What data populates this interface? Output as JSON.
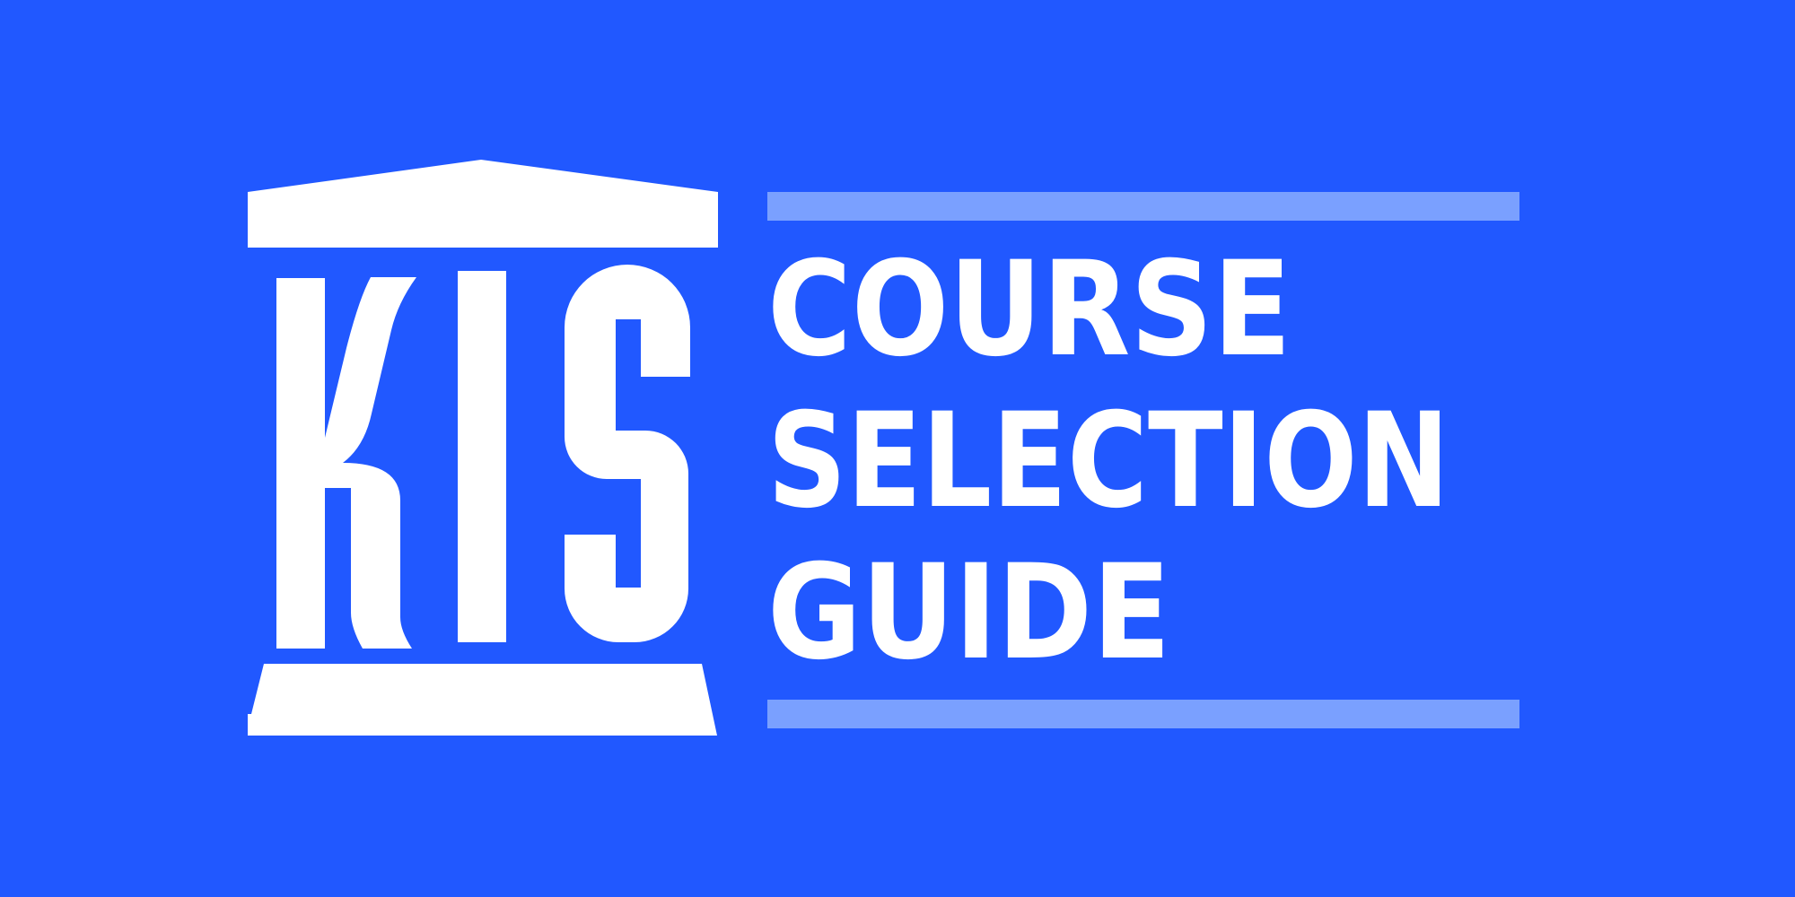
{
  "logo": {
    "wordmark": "KIS",
    "icon": "pillared-building-icon",
    "color": "#FFFFFF"
  },
  "title": {
    "lines": [
      "COURSE",
      "SELECTION",
      "GUIDE"
    ]
  },
  "colors": {
    "background": "#2158FF",
    "text": "#FFFFFF",
    "rule": "#7AA0FF"
  }
}
